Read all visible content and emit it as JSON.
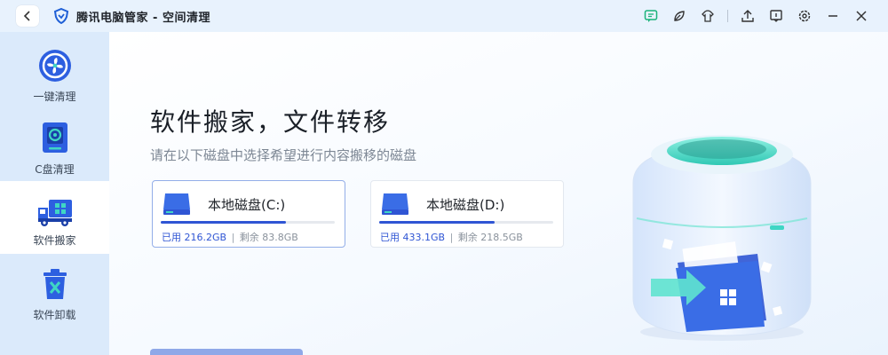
{
  "window": {
    "title": "腾讯电脑管家 - 空间清理",
    "back_icon": "chevron-left-icon"
  },
  "title_actions": [
    "feedback-icon",
    "skin-icon",
    "clothes-icon",
    "upload-icon",
    "message-icon",
    "settings-icon",
    "minimize-icon",
    "close-icon"
  ],
  "sidebar": {
    "items": [
      {
        "label": "一键清理",
        "icon": "fan-clean-icon",
        "active": false
      },
      {
        "label": "C盘清理",
        "icon": "c-drive-icon",
        "active": false
      },
      {
        "label": "软件搬家",
        "icon": "truck-icon",
        "active": true
      },
      {
        "label": "软件卸载",
        "icon": "trash-icon",
        "active": false
      }
    ]
  },
  "main": {
    "title": "软件搬家，文件转移",
    "subtitle": "请在以下磁盘中选择希望进行内容搬移的磁盘",
    "disks": [
      {
        "name": "本地磁盘(C:)",
        "used_label": "已用 216.2GB",
        "free_label": "剩余 83.8GB",
        "used_fraction": 0.72,
        "selected": true
      },
      {
        "name": "本地磁盘(D:)",
        "used_label": "已用 433.1GB",
        "free_label": "剩余 218.5GB",
        "used_fraction": 0.665,
        "selected": false
      }
    ],
    "separator": "|"
  },
  "colors": {
    "accent": "#2f55d4",
    "sidebar_bg": "#dbeafb",
    "titlebar_bg": "#e8f2fd",
    "teal": "#3fd6c4"
  }
}
